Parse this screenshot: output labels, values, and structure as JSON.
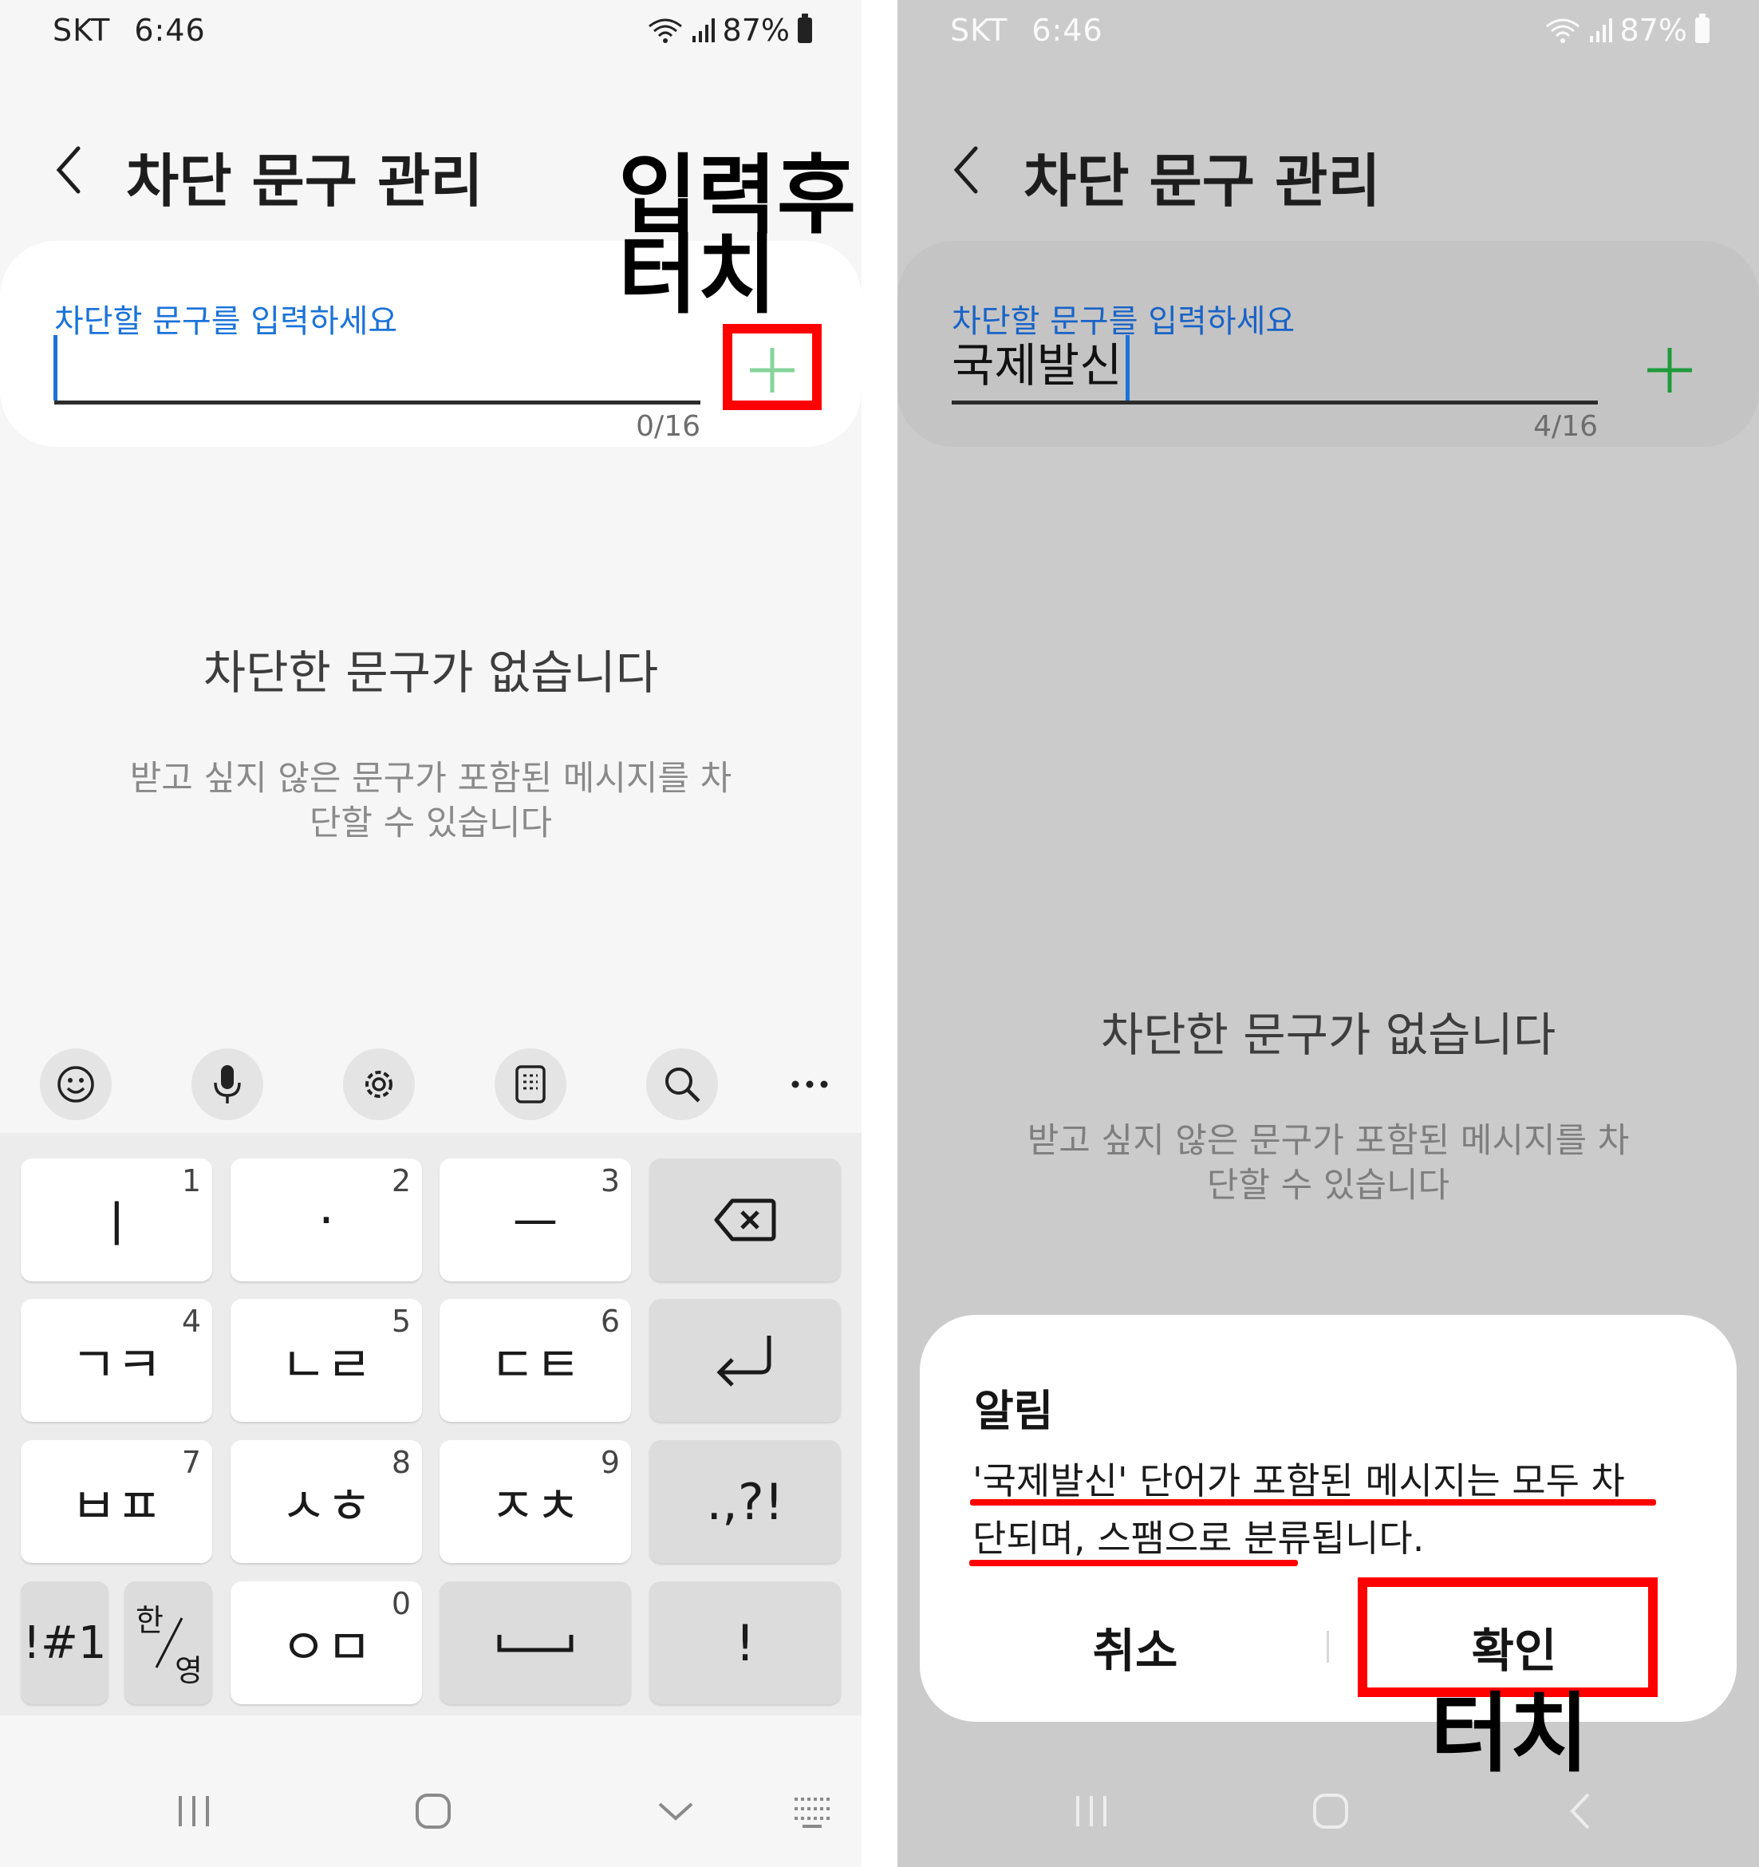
{
  "status": {
    "carrier": "SKT",
    "time": "6:46",
    "battery": "87%"
  },
  "page": {
    "title": "차단 문구 관리"
  },
  "left_input": {
    "label": "차단할 문구를 입력하세요",
    "value": "",
    "counter": "0/16"
  },
  "right_input": {
    "label": "차단할 문구를 입력하세요",
    "value": "국제발신",
    "counter": "4/16"
  },
  "empty_state": {
    "title": "차단한 문구가 없습니다",
    "desc_line1": "받고 싶지 않은 문구가 포함된 메시지를 차",
    "desc_line2": "단할 수 있습니다"
  },
  "keyboard": {
    "keys": {
      "k1": {
        "label": "ㅣ",
        "num": "1"
      },
      "k2": {
        "label": "·",
        "num": "2"
      },
      "k3": {
        "label": "ㅡ",
        "num": "3"
      },
      "k4": {
        "label": "ㄱㅋ",
        "num": "4"
      },
      "k5": {
        "label": "ㄴㄹ",
        "num": "5"
      },
      "k6": {
        "label": "ㄷㅌ",
        "num": "6"
      },
      "k7": {
        "label": "ㅂㅍ",
        "num": "7"
      },
      "k8": {
        "label": "ㅅㅎ",
        "num": "8"
      },
      "k9": {
        "label": "ㅈㅊ",
        "num": "9"
      },
      "k0": {
        "label": "ㅇㅁ",
        "num": "0"
      },
      "punct": ".,?!",
      "symbols": "!#1",
      "lang_top": "한",
      "lang_bottom": "영",
      "exclaim": "!"
    }
  },
  "dialog": {
    "title": "알림",
    "message_line1": "'국제발신' 단어가 포함된 메시지는 모두 차",
    "message_line2": "단되며, 스팸으로 분류됩니다.",
    "cancel_label": "취소",
    "confirm_label": "확인"
  },
  "annotations": {
    "left_line1": "입력후",
    "left_line2": "터치",
    "right": "터치",
    "color": "#ff0000"
  },
  "colors": {
    "accent": "#1a73d9",
    "plus_left": "#86d49a",
    "plus_right": "#1f9b3d"
  }
}
